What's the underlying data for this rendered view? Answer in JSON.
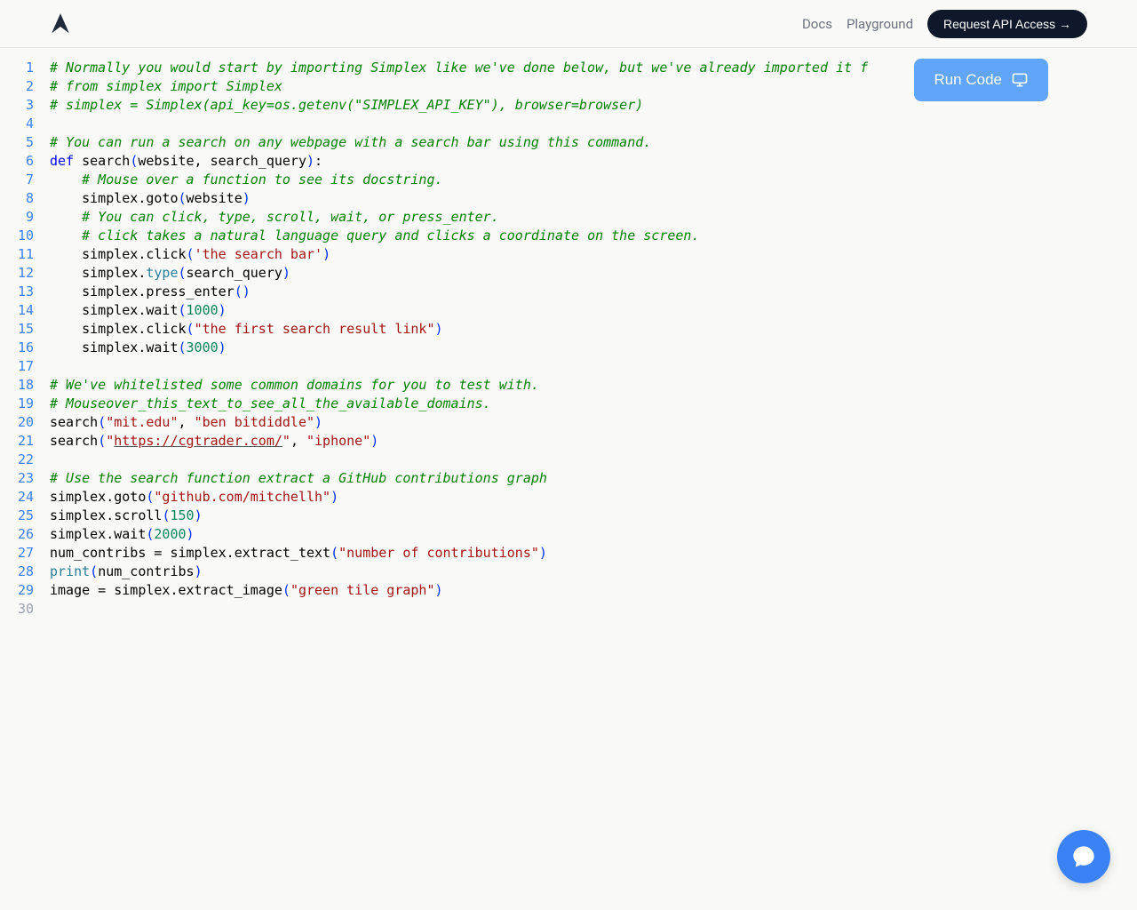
{
  "nav": {
    "docs": "Docs",
    "playground": "Playground",
    "cta": "Request API Access  →"
  },
  "run_button": "Run Code",
  "code_lines": [
    {
      "n": "1",
      "tokens": [
        {
          "t": "# Normally you would start by importing Simplex like we've done below, but we've already imported it f",
          "c": "tok-comment"
        }
      ]
    },
    {
      "n": "2",
      "tokens": [
        {
          "t": "# from simplex import Simplex",
          "c": "tok-comment"
        }
      ]
    },
    {
      "n": "3",
      "tokens": [
        {
          "t": "# simplex = Simplex(api_key=os.getenv(\"SIMPLEX_API_KEY\"), browser=browser)",
          "c": "tok-comment"
        }
      ]
    },
    {
      "n": "4",
      "tokens": []
    },
    {
      "n": "5",
      "tokens": [
        {
          "t": "# You can run a search on any webpage with a search bar using this command.",
          "c": "tok-comment"
        }
      ]
    },
    {
      "n": "6",
      "tokens": [
        {
          "t": "def",
          "c": "tok-keyword"
        },
        {
          "t": " "
        },
        {
          "t": "search",
          "c": "tok-def"
        },
        {
          "t": "(",
          "c": "tok-paren"
        },
        {
          "t": "website, search_query"
        },
        {
          "t": ")",
          "c": "tok-paren"
        },
        {
          "t": ":"
        }
      ]
    },
    {
      "n": "7",
      "indent": 1,
      "tokens": [
        {
          "t": "    "
        },
        {
          "t": "# Mouse over a function to see its docstring.",
          "c": "tok-comment"
        }
      ]
    },
    {
      "n": "8",
      "indent": 1,
      "tokens": [
        {
          "t": "    simplex.goto"
        },
        {
          "t": "(",
          "c": "tok-paren"
        },
        {
          "t": "website"
        },
        {
          "t": ")",
          "c": "tok-paren"
        }
      ]
    },
    {
      "n": "9",
      "indent": 1,
      "tokens": [
        {
          "t": "    "
        },
        {
          "t": "# You can click, type, scroll, wait, or press_enter.",
          "c": "tok-comment"
        }
      ]
    },
    {
      "n": "10",
      "indent": 1,
      "tokens": [
        {
          "t": "    "
        },
        {
          "t": "# click takes a natural language query and clicks a coordinate on the screen.",
          "c": "tok-comment"
        }
      ]
    },
    {
      "n": "11",
      "indent": 1,
      "tokens": [
        {
          "t": "    simplex.click"
        },
        {
          "t": "(",
          "c": "tok-paren"
        },
        {
          "t": "'the search bar'",
          "c": "tok-string"
        },
        {
          "t": ")",
          "c": "tok-paren"
        }
      ]
    },
    {
      "n": "12",
      "indent": 1,
      "tokens": [
        {
          "t": "    simplex."
        },
        {
          "t": "type",
          "c": "tok-builtin"
        },
        {
          "t": "(",
          "c": "tok-paren"
        },
        {
          "t": "search_query"
        },
        {
          "t": ")",
          "c": "tok-paren"
        }
      ]
    },
    {
      "n": "13",
      "indent": 1,
      "tokens": [
        {
          "t": "    simplex.press_enter"
        },
        {
          "t": "(",
          "c": "tok-paren"
        },
        {
          "t": ")",
          "c": "tok-paren"
        }
      ]
    },
    {
      "n": "14",
      "indent": 1,
      "tokens": [
        {
          "t": "    simplex.wait"
        },
        {
          "t": "(",
          "c": "tok-paren"
        },
        {
          "t": "1000",
          "c": "tok-number"
        },
        {
          "t": ")",
          "c": "tok-paren"
        }
      ]
    },
    {
      "n": "15",
      "indent": 1,
      "tokens": [
        {
          "t": "    simplex.click"
        },
        {
          "t": "(",
          "c": "tok-paren"
        },
        {
          "t": "\"the first search result link\"",
          "c": "tok-string"
        },
        {
          "t": ")",
          "c": "tok-paren"
        }
      ]
    },
    {
      "n": "16",
      "indent": 1,
      "tokens": [
        {
          "t": "    simplex.wait"
        },
        {
          "t": "(",
          "c": "tok-paren"
        },
        {
          "t": "3000",
          "c": "tok-number"
        },
        {
          "t": ")",
          "c": "tok-paren"
        }
      ]
    },
    {
      "n": "17",
      "tokens": []
    },
    {
      "n": "18",
      "tokens": [
        {
          "t": "# We've whitelisted some common domains for you to test with.",
          "c": "tok-comment"
        }
      ]
    },
    {
      "n": "19",
      "tokens": [
        {
          "t": "# Mouseover_this_text_to_see_all_the_available_domains.",
          "c": "tok-comment"
        }
      ]
    },
    {
      "n": "20",
      "tokens": [
        {
          "t": "search"
        },
        {
          "t": "(",
          "c": "tok-paren"
        },
        {
          "t": "\"mit.edu\"",
          "c": "tok-string"
        },
        {
          "t": ", "
        },
        {
          "t": "\"ben bitdiddle\"",
          "c": "tok-string"
        },
        {
          "t": ")",
          "c": "tok-paren"
        }
      ]
    },
    {
      "n": "21",
      "tokens": [
        {
          "t": "search"
        },
        {
          "t": "(",
          "c": "tok-paren"
        },
        {
          "t": "\"",
          "c": "tok-string"
        },
        {
          "t": "https://cgtrader.com/",
          "c": "tok-link"
        },
        {
          "t": "\"",
          "c": "tok-string"
        },
        {
          "t": ", "
        },
        {
          "t": "\"iphone\"",
          "c": "tok-string"
        },
        {
          "t": ")",
          "c": "tok-paren"
        }
      ]
    },
    {
      "n": "22",
      "tokens": []
    },
    {
      "n": "23",
      "tokens": [
        {
          "t": "# Use the search function extract a GitHub contributions graph",
          "c": "tok-comment"
        }
      ]
    },
    {
      "n": "24",
      "tokens": [
        {
          "t": "simplex.goto"
        },
        {
          "t": "(",
          "c": "tok-paren"
        },
        {
          "t": "\"github.com/mitchellh\"",
          "c": "tok-string"
        },
        {
          "t": ")",
          "c": "tok-paren"
        }
      ]
    },
    {
      "n": "25",
      "tokens": [
        {
          "t": "simplex.scroll"
        },
        {
          "t": "(",
          "c": "tok-paren"
        },
        {
          "t": "150",
          "c": "tok-number"
        },
        {
          "t": ")",
          "c": "tok-paren"
        }
      ]
    },
    {
      "n": "26",
      "tokens": [
        {
          "t": "simplex.wait"
        },
        {
          "t": "(",
          "c": "tok-paren"
        },
        {
          "t": "2000",
          "c": "tok-number"
        },
        {
          "t": ")",
          "c": "tok-paren"
        }
      ]
    },
    {
      "n": "27",
      "tokens": [
        {
          "t": "num_contribs = simplex.extract_text"
        },
        {
          "t": "(",
          "c": "tok-paren"
        },
        {
          "t": "\"number of contributions\"",
          "c": "tok-string"
        },
        {
          "t": ")",
          "c": "tok-paren"
        }
      ]
    },
    {
      "n": "28",
      "tokens": [
        {
          "t": "print",
          "c": "tok-builtin"
        },
        {
          "t": "(",
          "c": "tok-paren"
        },
        {
          "t": "num_contribs"
        },
        {
          "t": ")",
          "c": "tok-paren"
        }
      ]
    },
    {
      "n": "29",
      "tokens": [
        {
          "t": "image = simplex.extract_image"
        },
        {
          "t": "(",
          "c": "tok-paren"
        },
        {
          "t": "\"green tile graph\"",
          "c": "tok-string"
        },
        {
          "t": ")",
          "c": "tok-paren"
        }
      ]
    },
    {
      "n": "30",
      "dim": true,
      "tokens": []
    }
  ]
}
